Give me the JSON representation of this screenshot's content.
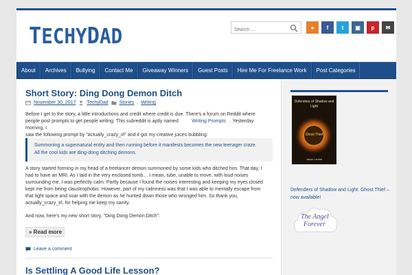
{
  "site": {
    "logo_first": "T",
    "logo_rest": "ECHY",
    "logo_first2": "D",
    "logo_rest2": "AD"
  },
  "search": {
    "placeholder": "Search ..."
  },
  "social": [
    {
      "name": "rss",
      "glyph": "●",
      "color": "#e8802a"
    },
    {
      "name": "facebook",
      "glyph": "f",
      "color": "#3b5998"
    },
    {
      "name": "twitter",
      "glyph": "t",
      "color": "#2aa2dc"
    },
    {
      "name": "instagram",
      "glyph": "▣",
      "color": "#3b6893"
    },
    {
      "name": "pinterest",
      "glyph": "p",
      "color": "#c8232c"
    },
    {
      "name": "email",
      "glyph": "✉",
      "color": "#444444"
    }
  ],
  "nav": [
    "About",
    "Archives",
    "Bullying",
    "Contact Me",
    "Giveaway Winners",
    "Guest Posts",
    "Hire Me For Freelance Work",
    "Post Categories"
  ],
  "post": {
    "title": "Short Story: Ding Dong Demon Ditch",
    "date": "November 30, 2017",
    "author": "TechyDad",
    "cat1": "Stories",
    "cat2": "Writing",
    "p1_line1": "Before I get to the story, a little introductions and credit where credit is due. There's a forum on Reddit where",
    "p1_line2a": "people post prompts to get people writing. This subreddit is aptly named",
    "p1_link": "Writing Prompts",
    "p1_line2b": ". Yesterday morning, I",
    "p1_line3": "saw the following prompt by \"actually_crazy_irl\" and it got my creative juices bubbling:",
    "quote_line1": "Summoning a supernatural entity and then running before it manifests becomes the new teenager craze.",
    "quote_line2": "All the cool kids are ding-dong ditching demons.",
    "p2_line1": "A story started forming in my head of a freelancer demon summoned by some kids who ditched him. That day, I",
    "p2_line2": "had to have an MRI. As I laid in the very enclosed tomb… I mean, tube, unable to move, with loud noises",
    "p2_line3": "surrounding me, I was perfectly calm. Partly because I found the noises interesting and keeping my eyes closed",
    "p2_line4": "kept me from being claustrophobic. However, part of my calmness was that I was able to mentally escape from",
    "p2_line5": "that tight space and soar with the demon as he hunted down those who wronged him. So thank you,",
    "p2_line6": "actually_crazy_irl, for helping me keep my sanity.",
    "p3": "And now, here's my new short story, \"Ding Dong Demon Ditch\":",
    "read_more": "» Read more",
    "comment": "Leave a comment"
  },
  "post2": {
    "title": "Is Settling A Good Life Lesson?"
  },
  "sidebar": {
    "book_title": "Defenders of Shadow and Light",
    "book_subtitle": "Ghost Thief",
    "book_author": "Jason Levine",
    "caption": "Defenders of Shadow and Light: Ghost Thief – now available!",
    "angel_line1": "The Angel",
    "angel_line2": "Forever"
  },
  "colors": {
    "brand": "#1e4f8a",
    "background": "#e8e8e8"
  }
}
